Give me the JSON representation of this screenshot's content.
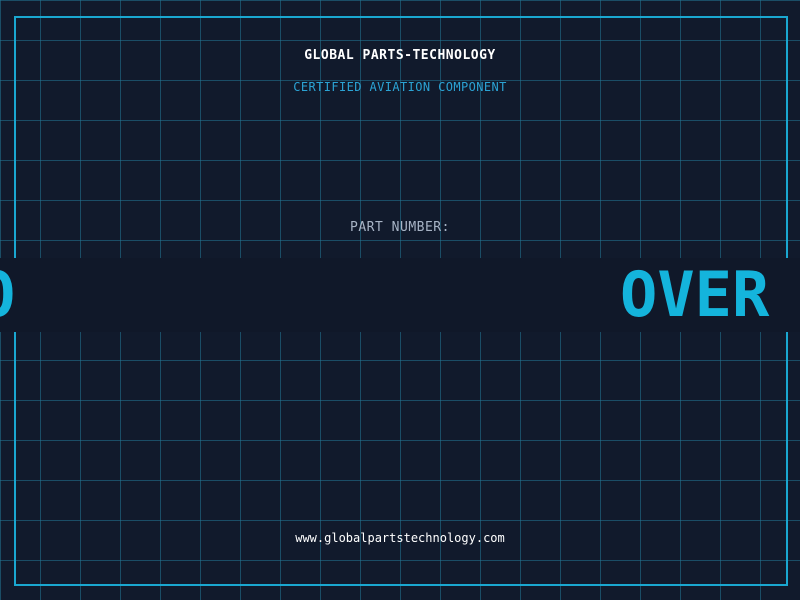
{
  "header": {
    "company_name": "GLOBAL PARTS-TECHNOLOGY",
    "tagline": "CERTIFIED AVIATION COMPONENT"
  },
  "part": {
    "label": "PART NUMBER:",
    "marquee_left_fragment": "O",
    "marquee_right_fragment": "OVER"
  },
  "footer": {
    "website": "www.globalpartstechnology.com"
  },
  "colors": {
    "background": "#111a2c",
    "accent": "#14b4dc",
    "frame": "#1aa7d0",
    "label": "#a8b4c6"
  }
}
